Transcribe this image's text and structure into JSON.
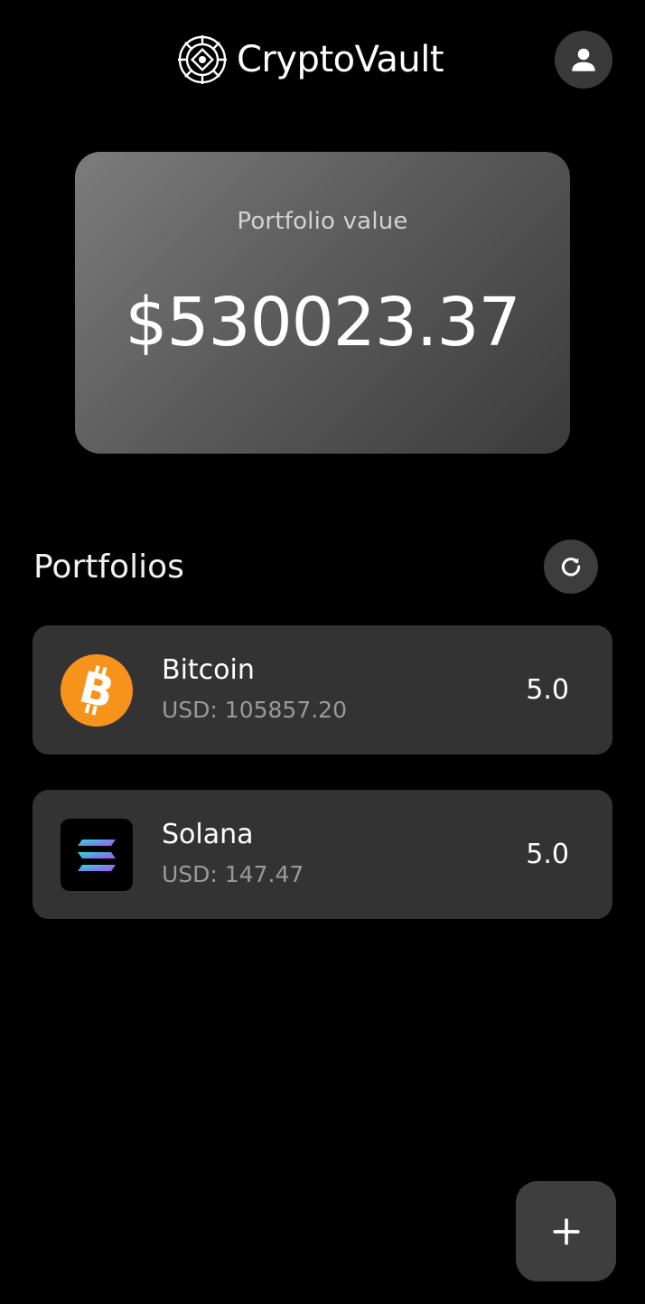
{
  "app": {
    "name": "CryptoVault",
    "logo_icon": "vault-logo-icon"
  },
  "header": {
    "profile_icon": "person-icon"
  },
  "summary": {
    "label": "Portfolio value",
    "value": "$530023.37"
  },
  "portfolios": {
    "title": "Portfolios",
    "refresh_icon": "refresh-icon",
    "items": [
      {
        "name": "Bitcoin",
        "price": "USD: 105857.20",
        "amount": "5.0",
        "icon": "bitcoin-icon",
        "color": "#F7931A"
      },
      {
        "name": "Solana",
        "price": "USD: 147.47",
        "amount": "5.0",
        "icon": "solana-icon",
        "color": "#000000"
      }
    ]
  },
  "fab": {
    "icon": "plus-icon"
  },
  "colors": {
    "background": "#000000",
    "card": "#333333",
    "muted_text": "#9A9A9A"
  }
}
